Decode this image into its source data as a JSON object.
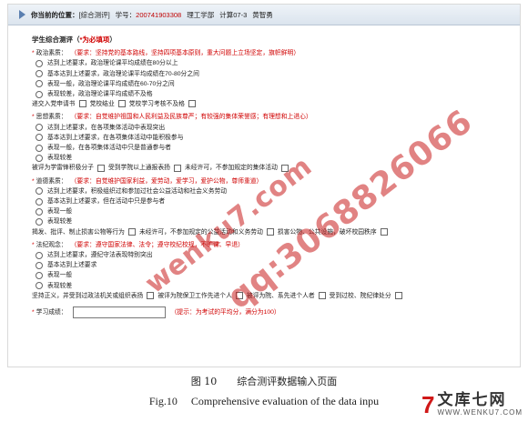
{
  "topbar": {
    "location_label": "你当前的位置：",
    "location_value": "[综合测评]",
    "student_id_label": "学号：",
    "student_id": "200741903308",
    "dept": "理工学部",
    "class": "计算07-3",
    "name": "黄智勇"
  },
  "form": {
    "title_main": "学生综合测评（",
    "title_star": "*为必填项",
    "title_end": "）",
    "sections": [
      {
        "label": "政治素质：",
        "requirement": "（要求：坚持党的基本路线，坚持四项基本原则，重大问题上立场坚定，旗帜鲜明）",
        "options": [
          "达到上述要求，政治理论课平均成绩在80分以上",
          "基本达到上述要求，政治理论课平均成绩在70-80分之间",
          "表现一般，政治理论课平均成绩在60-70分之间",
          "表现较差，政治理论课平均成绩不及格"
        ],
        "extras": [
          "递交入党申请书",
          "党校结业",
          "党校学习考核不及格"
        ]
      },
      {
        "label": "思想素质：",
        "requirement": "（要求：自觉维护祖国和人民利益及民族尊严；有较强的集体荣誉感；有理想和上进心）",
        "options": [
          "达到上述要求，在各项集体活动中表现突出",
          "基本达到上述要求，在各项集体活动中能积极参与",
          "表现一般，在各项集体活动中只是普通参与者",
          "表现较差"
        ],
        "extras": [
          "被评为学雷锋积极分子",
          "受到学院以上通报表扬",
          "未经许可，不参加规定的集体活动"
        ]
      },
      {
        "label": "道德素质：",
        "requirement": "（要求：自觉维护国家利益，爱劳动，爱学习，爱护公物，尊师重道）",
        "options": [
          "达到上述要求，积极组织过和参加过社会公益活动和社会义务劳动",
          "基本达到上述要求，但在活动中只是参与者",
          "表现一般",
          "表现较差"
        ],
        "extras": [
          "揭发、批评、制止损害公物等行为",
          "未经许可，不参加规定的公益活动和义务劳动",
          "损害公物、公共设施，破坏校园秩序"
        ]
      },
      {
        "label": "法纪观念：",
        "requirement": "（要求：遵守国家法律、法令；遵守校纪校规，不旷课、早退）",
        "options": [
          "达到上述要求，遵纪守法表现特别突出",
          "基本达到上述要求",
          "表现一般",
          "表现较差"
        ],
        "extras": [
          "坚持正义，并受到过政法机关或组织表扬",
          "被评为院保卫工作先进个人",
          "被评为院、系先进个人者",
          "受到过校、院纪律处分"
        ]
      }
    ],
    "score_label": "学习成绩：",
    "score_value": "",
    "score_hint": "（提示：为考试的平均分，满分为100）"
  },
  "captions": {
    "cn": "图 10　　综合测评数据输入页面",
    "en": "Fig.10　 Comprehensive evaluation of the data inpu"
  },
  "watermarks": {
    "site": "wenku7.com",
    "qq": "qq:3068826066"
  },
  "logo": {
    "mark": "7",
    "cn": "文库七网",
    "url": "WWW.WENKU7.COM"
  },
  "colors": {
    "accent_red": "#d00000",
    "topbar_bg": "#dbe4ee"
  }
}
